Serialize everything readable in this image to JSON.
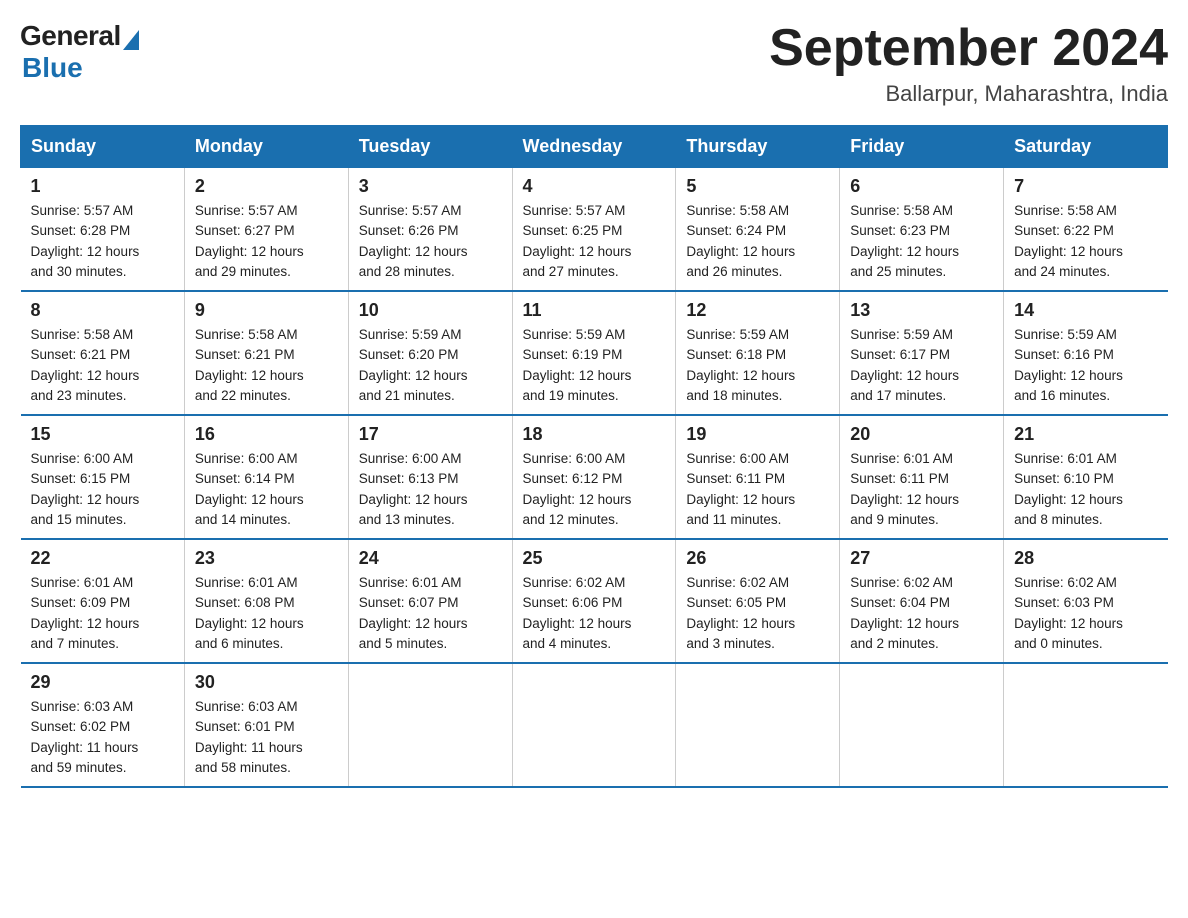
{
  "header": {
    "logo_general": "General",
    "logo_blue": "Blue",
    "month_title": "September 2024",
    "location": "Ballarpur, Maharashtra, India"
  },
  "days_of_week": [
    "Sunday",
    "Monday",
    "Tuesday",
    "Wednesday",
    "Thursday",
    "Friday",
    "Saturday"
  ],
  "weeks": [
    [
      {
        "day": "1",
        "sunrise": "5:57 AM",
        "sunset": "6:28 PM",
        "daylight": "12 hours and 30 minutes."
      },
      {
        "day": "2",
        "sunrise": "5:57 AM",
        "sunset": "6:27 PM",
        "daylight": "12 hours and 29 minutes."
      },
      {
        "day": "3",
        "sunrise": "5:57 AM",
        "sunset": "6:26 PM",
        "daylight": "12 hours and 28 minutes."
      },
      {
        "day": "4",
        "sunrise": "5:57 AM",
        "sunset": "6:25 PM",
        "daylight": "12 hours and 27 minutes."
      },
      {
        "day": "5",
        "sunrise": "5:58 AM",
        "sunset": "6:24 PM",
        "daylight": "12 hours and 26 minutes."
      },
      {
        "day": "6",
        "sunrise": "5:58 AM",
        "sunset": "6:23 PM",
        "daylight": "12 hours and 25 minutes."
      },
      {
        "day": "7",
        "sunrise": "5:58 AM",
        "sunset": "6:22 PM",
        "daylight": "12 hours and 24 minutes."
      }
    ],
    [
      {
        "day": "8",
        "sunrise": "5:58 AM",
        "sunset": "6:21 PM",
        "daylight": "12 hours and 23 minutes."
      },
      {
        "day": "9",
        "sunrise": "5:58 AM",
        "sunset": "6:21 PM",
        "daylight": "12 hours and 22 minutes."
      },
      {
        "day": "10",
        "sunrise": "5:59 AM",
        "sunset": "6:20 PM",
        "daylight": "12 hours and 21 minutes."
      },
      {
        "day": "11",
        "sunrise": "5:59 AM",
        "sunset": "6:19 PM",
        "daylight": "12 hours and 19 minutes."
      },
      {
        "day": "12",
        "sunrise": "5:59 AM",
        "sunset": "6:18 PM",
        "daylight": "12 hours and 18 minutes."
      },
      {
        "day": "13",
        "sunrise": "5:59 AM",
        "sunset": "6:17 PM",
        "daylight": "12 hours and 17 minutes."
      },
      {
        "day": "14",
        "sunrise": "5:59 AM",
        "sunset": "6:16 PM",
        "daylight": "12 hours and 16 minutes."
      }
    ],
    [
      {
        "day": "15",
        "sunrise": "6:00 AM",
        "sunset": "6:15 PM",
        "daylight": "12 hours and 15 minutes."
      },
      {
        "day": "16",
        "sunrise": "6:00 AM",
        "sunset": "6:14 PM",
        "daylight": "12 hours and 14 minutes."
      },
      {
        "day": "17",
        "sunrise": "6:00 AM",
        "sunset": "6:13 PM",
        "daylight": "12 hours and 13 minutes."
      },
      {
        "day": "18",
        "sunrise": "6:00 AM",
        "sunset": "6:12 PM",
        "daylight": "12 hours and 12 minutes."
      },
      {
        "day": "19",
        "sunrise": "6:00 AM",
        "sunset": "6:11 PM",
        "daylight": "12 hours and 11 minutes."
      },
      {
        "day": "20",
        "sunrise": "6:01 AM",
        "sunset": "6:11 PM",
        "daylight": "12 hours and 9 minutes."
      },
      {
        "day": "21",
        "sunrise": "6:01 AM",
        "sunset": "6:10 PM",
        "daylight": "12 hours and 8 minutes."
      }
    ],
    [
      {
        "day": "22",
        "sunrise": "6:01 AM",
        "sunset": "6:09 PM",
        "daylight": "12 hours and 7 minutes."
      },
      {
        "day": "23",
        "sunrise": "6:01 AM",
        "sunset": "6:08 PM",
        "daylight": "12 hours and 6 minutes."
      },
      {
        "day": "24",
        "sunrise": "6:01 AM",
        "sunset": "6:07 PM",
        "daylight": "12 hours and 5 minutes."
      },
      {
        "day": "25",
        "sunrise": "6:02 AM",
        "sunset": "6:06 PM",
        "daylight": "12 hours and 4 minutes."
      },
      {
        "day": "26",
        "sunrise": "6:02 AM",
        "sunset": "6:05 PM",
        "daylight": "12 hours and 3 minutes."
      },
      {
        "day": "27",
        "sunrise": "6:02 AM",
        "sunset": "6:04 PM",
        "daylight": "12 hours and 2 minutes."
      },
      {
        "day": "28",
        "sunrise": "6:02 AM",
        "sunset": "6:03 PM",
        "daylight": "12 hours and 0 minutes."
      }
    ],
    [
      {
        "day": "29",
        "sunrise": "6:03 AM",
        "sunset": "6:02 PM",
        "daylight": "11 hours and 59 minutes."
      },
      {
        "day": "30",
        "sunrise": "6:03 AM",
        "sunset": "6:01 PM",
        "daylight": "11 hours and 58 minutes."
      },
      null,
      null,
      null,
      null,
      null
    ]
  ],
  "labels": {
    "sunrise": "Sunrise:",
    "sunset": "Sunset:",
    "daylight": "Daylight:"
  }
}
